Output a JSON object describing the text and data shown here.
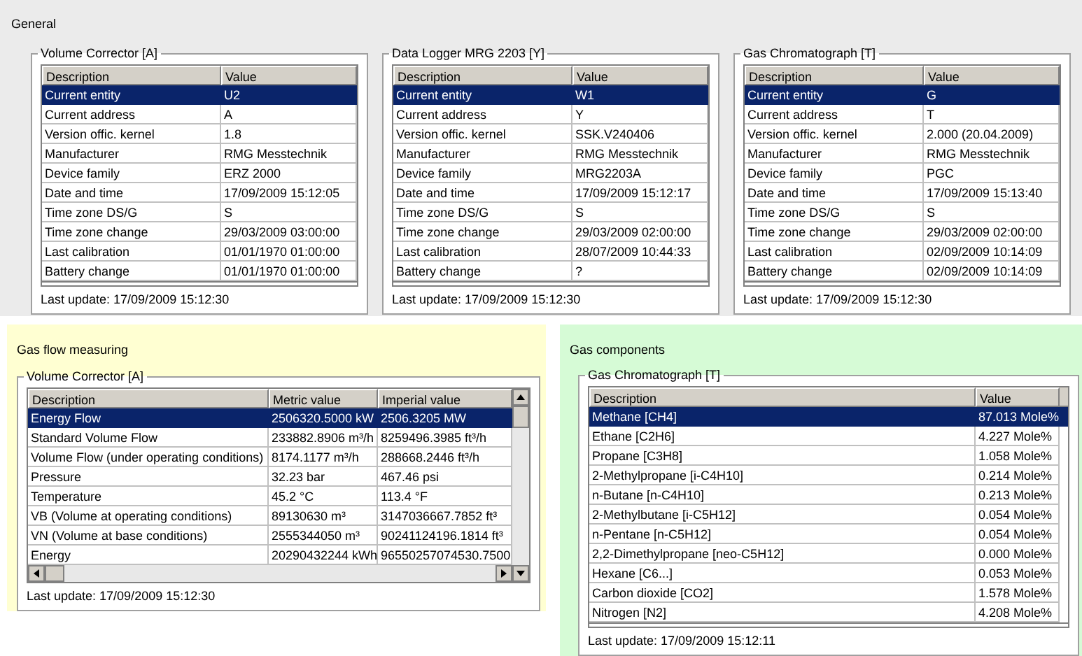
{
  "general": {
    "title": "General",
    "devices": [
      {
        "title": "Volume Corrector [A]",
        "columns": [
          "Description",
          "Value"
        ],
        "rows": [
          {
            "cells": [
              "Current entity",
              "U2"
            ],
            "selected": true
          },
          {
            "cells": [
              "Current address",
              "A"
            ],
            "selected": false
          },
          {
            "cells": [
              "Version offic. kernel",
              "1.8"
            ],
            "selected": false
          },
          {
            "cells": [
              "Manufacturer",
              "RMG Messtechnik"
            ],
            "selected": false
          },
          {
            "cells": [
              "Device family",
              "ERZ 2000"
            ],
            "selected": false
          },
          {
            "cells": [
              "Date and time",
              "17/09/2009 15:12:05"
            ],
            "selected": false
          },
          {
            "cells": [
              "Time zone DS/G",
              "S"
            ],
            "selected": false
          },
          {
            "cells": [
              "Time zone change",
              "29/03/2009 03:00:00"
            ],
            "selected": false
          },
          {
            "cells": [
              "Last calibration",
              "01/01/1970 01:00:00"
            ],
            "selected": false
          },
          {
            "cells": [
              "Battery change",
              "01/01/1970 01:00:00"
            ],
            "selected": false
          }
        ],
        "last_update": "Last update: 17/09/2009 15:12:30"
      },
      {
        "title": "Data Logger MRG 2203 [Y]",
        "columns": [
          "Description",
          "Value"
        ],
        "rows": [
          {
            "cells": [
              "Current entity",
              "W1"
            ],
            "selected": true
          },
          {
            "cells": [
              "Current address",
              "Y"
            ],
            "selected": false
          },
          {
            "cells": [
              "Version offic. kernel",
              "SSK.V240406"
            ],
            "selected": false
          },
          {
            "cells": [
              "Manufacturer",
              "RMG Messtechnik"
            ],
            "selected": false
          },
          {
            "cells": [
              "Device family",
              "MRG2203A"
            ],
            "selected": false
          },
          {
            "cells": [
              "Date and time",
              "17/09/2009 15:12:17"
            ],
            "selected": false
          },
          {
            "cells": [
              "Time zone DS/G",
              "S"
            ],
            "selected": false
          },
          {
            "cells": [
              "Time zone change",
              "29/03/2009 02:00:00"
            ],
            "selected": false
          },
          {
            "cells": [
              "Last calibration",
              "28/07/2009 10:44:33"
            ],
            "selected": false
          },
          {
            "cells": [
              "Battery change",
              "?"
            ],
            "selected": false
          }
        ],
        "last_update": "Last update: 17/09/2009 15:12:30"
      },
      {
        "title": "Gas Chromatograph [T]",
        "columns": [
          "Description",
          "Value"
        ],
        "rows": [
          {
            "cells": [
              "Current entity",
              "G"
            ],
            "selected": true
          },
          {
            "cells": [
              "Current address",
              "T"
            ],
            "selected": false
          },
          {
            "cells": [
              "Version offic. kernel",
              "2.000 (20.04.2009)"
            ],
            "selected": false
          },
          {
            "cells": [
              "Manufacturer",
              "RMG Messtechnik"
            ],
            "selected": false
          },
          {
            "cells": [
              "Device family",
              "PGC"
            ],
            "selected": false
          },
          {
            "cells": [
              "Date and time",
              "17/09/2009 15:13:40"
            ],
            "selected": false
          },
          {
            "cells": [
              "Time zone DS/G",
              "S"
            ],
            "selected": false
          },
          {
            "cells": [
              "Time zone change",
              "29/03/2009 02:00:00"
            ],
            "selected": false
          },
          {
            "cells": [
              "Last calibration",
              "02/09/2009 10:14:09"
            ],
            "selected": false
          },
          {
            "cells": [
              "Battery change",
              "02/09/2009 10:14:09"
            ],
            "selected": false
          }
        ],
        "last_update": "Last update: 17/09/2009 15:12:30"
      }
    ]
  },
  "gas_flow_measuring": {
    "title": "Gas flow measuring",
    "device": {
      "title": "Volume Corrector [A]",
      "columns": [
        "Description",
        "Metric value",
        "Imperial value"
      ],
      "rows": [
        {
          "cells": [
            "Energy Flow",
            "2506320.5000 kW",
            "2506.3205 MW"
          ],
          "selected": true
        },
        {
          "cells": [
            "Standard Volume Flow",
            "233882.8906 m³/h",
            "8259496.3985 ft³/h"
          ],
          "selected": false
        },
        {
          "cells": [
            "Volume Flow (under operating conditions)",
            "8174.1177 m³/h",
            "288668.2446 ft³/h"
          ],
          "selected": false
        },
        {
          "cells": [
            "Pressure",
            "32.23 bar",
            "467.46 psi"
          ],
          "selected": false
        },
        {
          "cells": [
            "Temperature",
            "45.2 °C",
            "113.4 °F"
          ],
          "selected": false
        },
        {
          "cells": [
            "VB (Volume at operating conditions)",
            "89130630 m³",
            "3147036667.7852 ft³"
          ],
          "selected": false
        },
        {
          "cells": [
            "VN (Volume at base conditions)",
            "2555344050 m³",
            "90241124196.1814 ft³"
          ],
          "selected": false
        },
        {
          "cells": [
            "Energy",
            "20290432244 kWh",
            "96550257074530.7500"
          ],
          "selected": false
        }
      ],
      "last_update": "Last update: 17/09/2009 15:12:30"
    }
  },
  "gas_components": {
    "title": "Gas components",
    "device": {
      "title": "Gas Chromatograph [T]",
      "columns": [
        "Description",
        "Value"
      ],
      "rows": [
        {
          "cells": [
            "Methane [CH4]",
            "87.013 Mole%"
          ],
          "selected": true
        },
        {
          "cells": [
            "Ethane [C2H6]",
            "4.227 Mole%"
          ],
          "selected": false
        },
        {
          "cells": [
            "Propane [C3H8]",
            "1.058 Mole%"
          ],
          "selected": false
        },
        {
          "cells": [
            "2-Methylpropane [i-C4H10]",
            "0.214 Mole%"
          ],
          "selected": false
        },
        {
          "cells": [
            "n-Butane [n-C4H10]",
            "0.213 Mole%"
          ],
          "selected": false
        },
        {
          "cells": [
            "2-Methylbutane [i-C5H12]",
            "0.054 Mole%"
          ],
          "selected": false
        },
        {
          "cells": [
            "n-Pentane [n-C5H12]",
            "0.054 Mole%"
          ],
          "selected": false
        },
        {
          "cells": [
            "2,2-Dimethylpropane [neo-C5H12]",
            "0.000 Mole%"
          ],
          "selected": false
        },
        {
          "cells": [
            "Hexane [C6...]",
            "0.053 Mole%"
          ],
          "selected": false
        },
        {
          "cells": [
            "Carbon dioxide [CO2]",
            "1.578 Mole%"
          ],
          "selected": false
        },
        {
          "cells": [
            "Nitrogen [N2]",
            "4.208 Mole%"
          ],
          "selected": false
        }
      ],
      "last_update": "Last update: 17/09/2009 15:12:11"
    }
  }
}
